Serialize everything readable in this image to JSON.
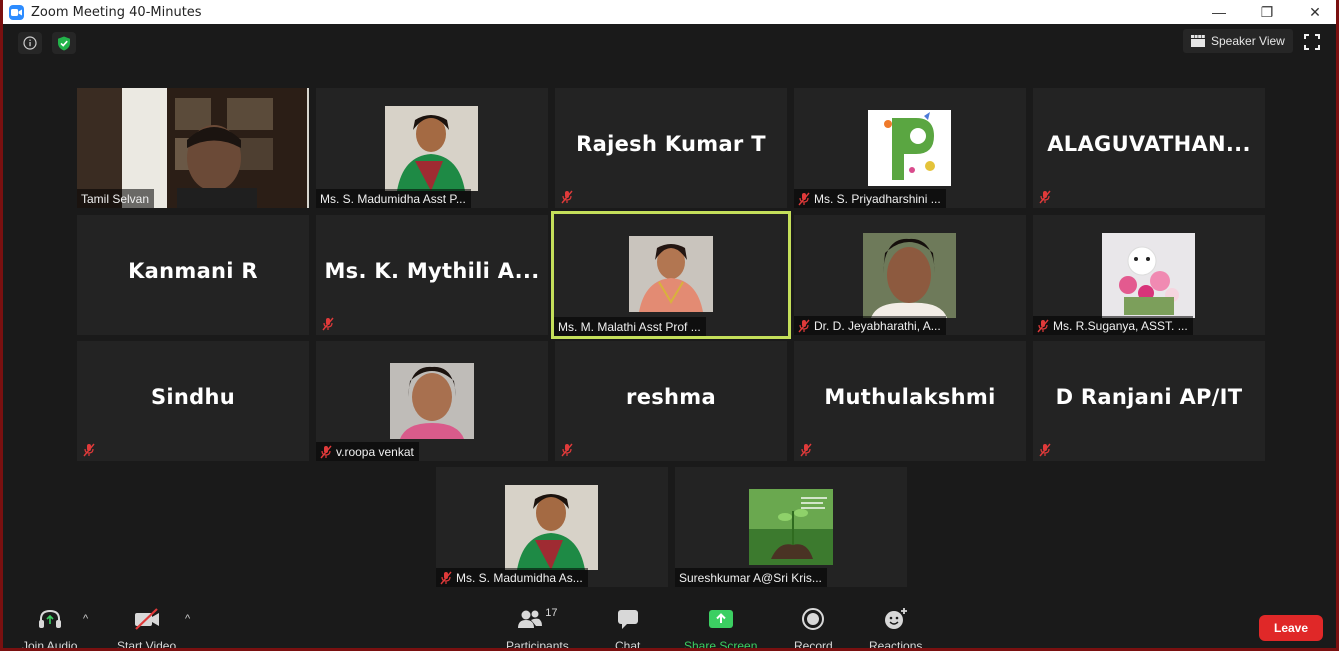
{
  "window": {
    "title": "Zoom Meeting 40-Minutes",
    "minimize": "—",
    "restore": "❐",
    "close": "✕"
  },
  "top": {
    "view_label": "Speaker View"
  },
  "tiles": [
    {
      "name": "Tamil Selvan",
      "display": "",
      "type": "video"
    },
    {
      "name": "Ms. S. Madumidha Asst P...",
      "display": "",
      "type": "photo"
    },
    {
      "name": "",
      "display": "Rajesh Kumar T",
      "type": "text"
    },
    {
      "name": "Ms. S. Priyadharshini ...",
      "display": "",
      "type": "photo"
    },
    {
      "name": "",
      "display": "ALAGUVATHAN...",
      "type": "text"
    },
    {
      "name": "",
      "display": "Kanmani R",
      "type": "text"
    },
    {
      "name": "",
      "display": "Ms. K. Mythili A...",
      "type": "text"
    },
    {
      "name": "Ms. M. Malathi Asst Prof ...",
      "display": "",
      "type": "photo",
      "active": true
    },
    {
      "name": "Dr. D. Jeyabharathi, A...",
      "display": "",
      "type": "photo"
    },
    {
      "name": "Ms. R.Suganya, ASST. ...",
      "display": "",
      "type": "photo"
    },
    {
      "name": "",
      "display": "Sindhu",
      "type": "text"
    },
    {
      "name": "v.roopa venkat",
      "display": "",
      "type": "photo"
    },
    {
      "name": "",
      "display": "reshma",
      "type": "text"
    },
    {
      "name": "",
      "display": "Muthulakshmi",
      "type": "text"
    },
    {
      "name": "",
      "display": "D Ranjani AP/IT",
      "type": "text"
    },
    {
      "name": "Ms. S. Madumidha As...",
      "display": "",
      "type": "photo"
    },
    {
      "name": "Sureshkumar A@Sri Kris...",
      "display": "",
      "type": "photo"
    }
  ],
  "toolbar": {
    "join_audio": "Join Audio",
    "start_video": "Start Video",
    "participants": "Participants",
    "participants_count": "17",
    "chat": "Chat",
    "share_screen": "Share Screen",
    "record": "Record",
    "reactions": "Reactions",
    "leave": "Leave"
  },
  "colors": {
    "background": "#1a1a1a",
    "tile": "#232323",
    "active_border": "#c4df5a",
    "share_green": "#3ccf62",
    "leave_red": "#e02828",
    "mute_red": "#e03a3a"
  }
}
